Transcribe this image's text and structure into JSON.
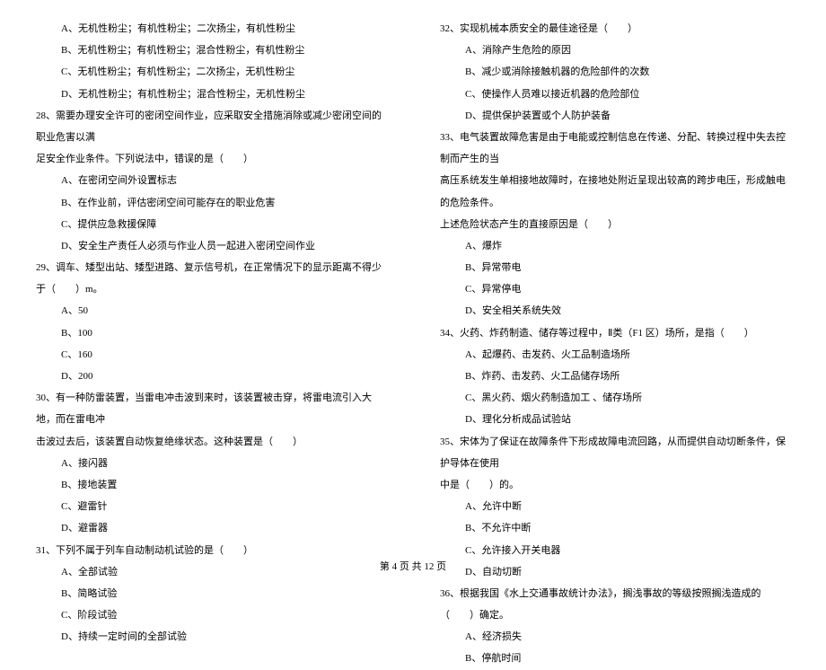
{
  "left_column": [
    {
      "cls": "option",
      "text": "A、无机性粉尘；有机性粉尘；二次扬尘，有机性粉尘"
    },
    {
      "cls": "option",
      "text": "B、无机性粉尘；有机性粉尘；混合性粉尘，有机性粉尘"
    },
    {
      "cls": "option",
      "text": "C、无机性粉尘；有机性粉尘；二次扬尘，无机性粉尘"
    },
    {
      "cls": "option",
      "text": "D、无机性粉尘；有机性粉尘；混合性粉尘，无机性粉尘"
    },
    {
      "cls": "question",
      "text": "28、需要办理安全许可的密闭空间作业，应采取安全措施消除或减少密闭空间的职业危害以满"
    },
    {
      "cls": "question",
      "text": "足安全作业条件。下列说法中，错误的是（　　）"
    },
    {
      "cls": "option",
      "text": "A、在密闭空间外设置标志"
    },
    {
      "cls": "option",
      "text": "B、在作业前，评估密闭空间可能存在的职业危害"
    },
    {
      "cls": "option",
      "text": "C、提供应急救援保障"
    },
    {
      "cls": "option",
      "text": "D、安全生产责任人必须与作业人员一起进入密闭空间作业"
    },
    {
      "cls": "question",
      "text": "29、调车、矮型出站、矮型进路、复示信号机，在正常情况下的显示距离不得少于（　　）m。"
    },
    {
      "cls": "option",
      "text": "A、50"
    },
    {
      "cls": "option",
      "text": "B、100"
    },
    {
      "cls": "option",
      "text": "C、160"
    },
    {
      "cls": "option",
      "text": "D、200"
    },
    {
      "cls": "question",
      "text": "30、有一种防雷装置，当雷电冲击波到来时，该装置被击穿，将雷电流引入大地，而在雷电冲"
    },
    {
      "cls": "question",
      "text": "击波过去后，该装置自动恢复绝缘状态。这种装置是（　　）"
    },
    {
      "cls": "option",
      "text": "A、接闪器"
    },
    {
      "cls": "option",
      "text": "B、接地装置"
    },
    {
      "cls": "option",
      "text": "C、避雷针"
    },
    {
      "cls": "option",
      "text": "D、避雷器"
    },
    {
      "cls": "question",
      "text": "31、下列不属于列车自动制动机试验的是（　　）"
    },
    {
      "cls": "option",
      "text": "A、全部试验"
    },
    {
      "cls": "option",
      "text": "B、简略试验"
    },
    {
      "cls": "option",
      "text": "C、阶段试验"
    },
    {
      "cls": "option",
      "text": "D、持续一定时间的全部试验"
    }
  ],
  "right_column": [
    {
      "cls": "question",
      "text": "32、实现机械本质安全的最佳途径是（　　）"
    },
    {
      "cls": "option",
      "text": "A、消除产生危险的原因"
    },
    {
      "cls": "option",
      "text": "B、减少或消除接触机器的危险部件的次数"
    },
    {
      "cls": "option",
      "text": "C、使操作人员难以接近机器的危险部位"
    },
    {
      "cls": "option",
      "text": "D、提供保护装置或个人防护装备"
    },
    {
      "cls": "question",
      "text": "33、电气装置故障危害是由于电能或控制信息在传递、分配、转换过程中失去控制而产生的当"
    },
    {
      "cls": "question",
      "text": "高压系统发生单相接地故障时，在接地处附近呈现出较高的跨步电压，形成触电的危险条件。"
    },
    {
      "cls": "question",
      "text": "上述危险状态产生的直接原因是（　　）"
    },
    {
      "cls": "option",
      "text": "A、爆炸"
    },
    {
      "cls": "option",
      "text": "B、异常带电"
    },
    {
      "cls": "option",
      "text": "C、异常停电"
    },
    {
      "cls": "option",
      "text": "D、安全相关系统失效"
    },
    {
      "cls": "question",
      "text": "34、火药、炸药制造、储存等过程中，Ⅱ类（F1 区）场所，是指（　　）"
    },
    {
      "cls": "option",
      "text": "A、起爆药、击发药、火工品制造场所"
    },
    {
      "cls": "option",
      "text": "B、炸药、击发药、火工品储存场所"
    },
    {
      "cls": "option",
      "text": "C、黑火药、烟火药制造加工 、储存场所"
    },
    {
      "cls": "option",
      "text": "D、理化分析成品试验站"
    },
    {
      "cls": "question",
      "text": "35、宋体为了保证在故障条件下形成故障电流回路，从而提供自动切断条件，保护导体在使用"
    },
    {
      "cls": "question",
      "text": "中是（　　）的。"
    },
    {
      "cls": "option",
      "text": "A、允许中断"
    },
    {
      "cls": "option",
      "text": "B、不允许中断"
    },
    {
      "cls": "option",
      "text": "C、允许接入开关电器"
    },
    {
      "cls": "option",
      "text": "D、自动切断"
    },
    {
      "cls": "question",
      "text": "36、根据我国《水上交通事故统计办法》，搁浅事故的等级按照搁浅造成的（　　）确定。"
    },
    {
      "cls": "option",
      "text": "A、经济损失"
    },
    {
      "cls": "option",
      "text": "B、停航时间"
    }
  ],
  "footer": "第 4 页 共 12 页"
}
